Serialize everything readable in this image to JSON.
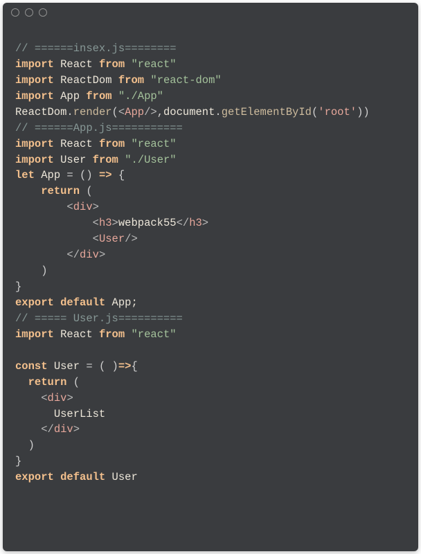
{
  "comment1": "// ======insex.js========",
  "l2": {
    "kw1": "import",
    "id": "React",
    "kw2": "from",
    "str": "\"react\""
  },
  "l3": {
    "kw1": "import",
    "id": "ReactDom",
    "kw2": "from",
    "str": "\"react-dom\""
  },
  "l4": {
    "kw1": "import",
    "id": "App",
    "kw2": "from",
    "str": "\"./App\""
  },
  "l5": {
    "obj": "ReactDom",
    "dot": ".",
    "fn": "render",
    "open": "(",
    "lt1": "<",
    "tag": "App",
    "slashgt": "/>",
    "comma": ",",
    "doc": "document",
    "dot2": ".",
    "fn2": "getElementById",
    "open2": "(",
    "arg": "'root'",
    "close2": ")",
    "close": ")"
  },
  "comment2": "// ======App.js===========",
  "l7": {
    "kw1": "import",
    "id": "React",
    "kw2": "from",
    "str": "\"react\""
  },
  "l8": {
    "kw1": "import",
    "id": "User",
    "kw2": "from",
    "str": "\"./User\""
  },
  "l9": {
    "kw": "let",
    "id": "App",
    "eq": " = () ",
    "arrow": "=>",
    "brace": " {"
  },
  "l10": {
    "kw": "return",
    "paren": " ("
  },
  "l11": {
    "lt": "<",
    "tag": "div",
    "gt": ">"
  },
  "l12": {
    "lt": "<",
    "tag": "h3",
    "gt": ">",
    "text": "webpack55",
    "lt2": "</",
    "tag2": "h3",
    "gt2": ">"
  },
  "l13": {
    "lt": "<",
    "tag": "User",
    "slashgt": "/>"
  },
  "l14": {
    "lt": "</",
    "tag": "div",
    "gt": ">"
  },
  "l15": ")",
  "l16": "}",
  "l17": {
    "kw": "export default",
    "id": " App;"
  },
  "comment3": "// ===== User.js==========",
  "l19": {
    "kw1": "import",
    "id": "React",
    "kw2": "from",
    "str": "\"react\""
  },
  "blank": "",
  "l21": {
    "kw": "const",
    "id": "User",
    "eq": " = ( )",
    "arrow": "=>",
    "brace": "{"
  },
  "l22": {
    "kw": "return",
    "paren": " ("
  },
  "l23": {
    "lt": "<",
    "tag": "div",
    "gt": ">"
  },
  "l24": "UserList",
  "l25": {
    "lt": "</",
    "tag": "div",
    "gt": ">"
  },
  "l26": ")",
  "l27": "}",
  "l28": {
    "kw": "export default",
    "id": " User"
  }
}
